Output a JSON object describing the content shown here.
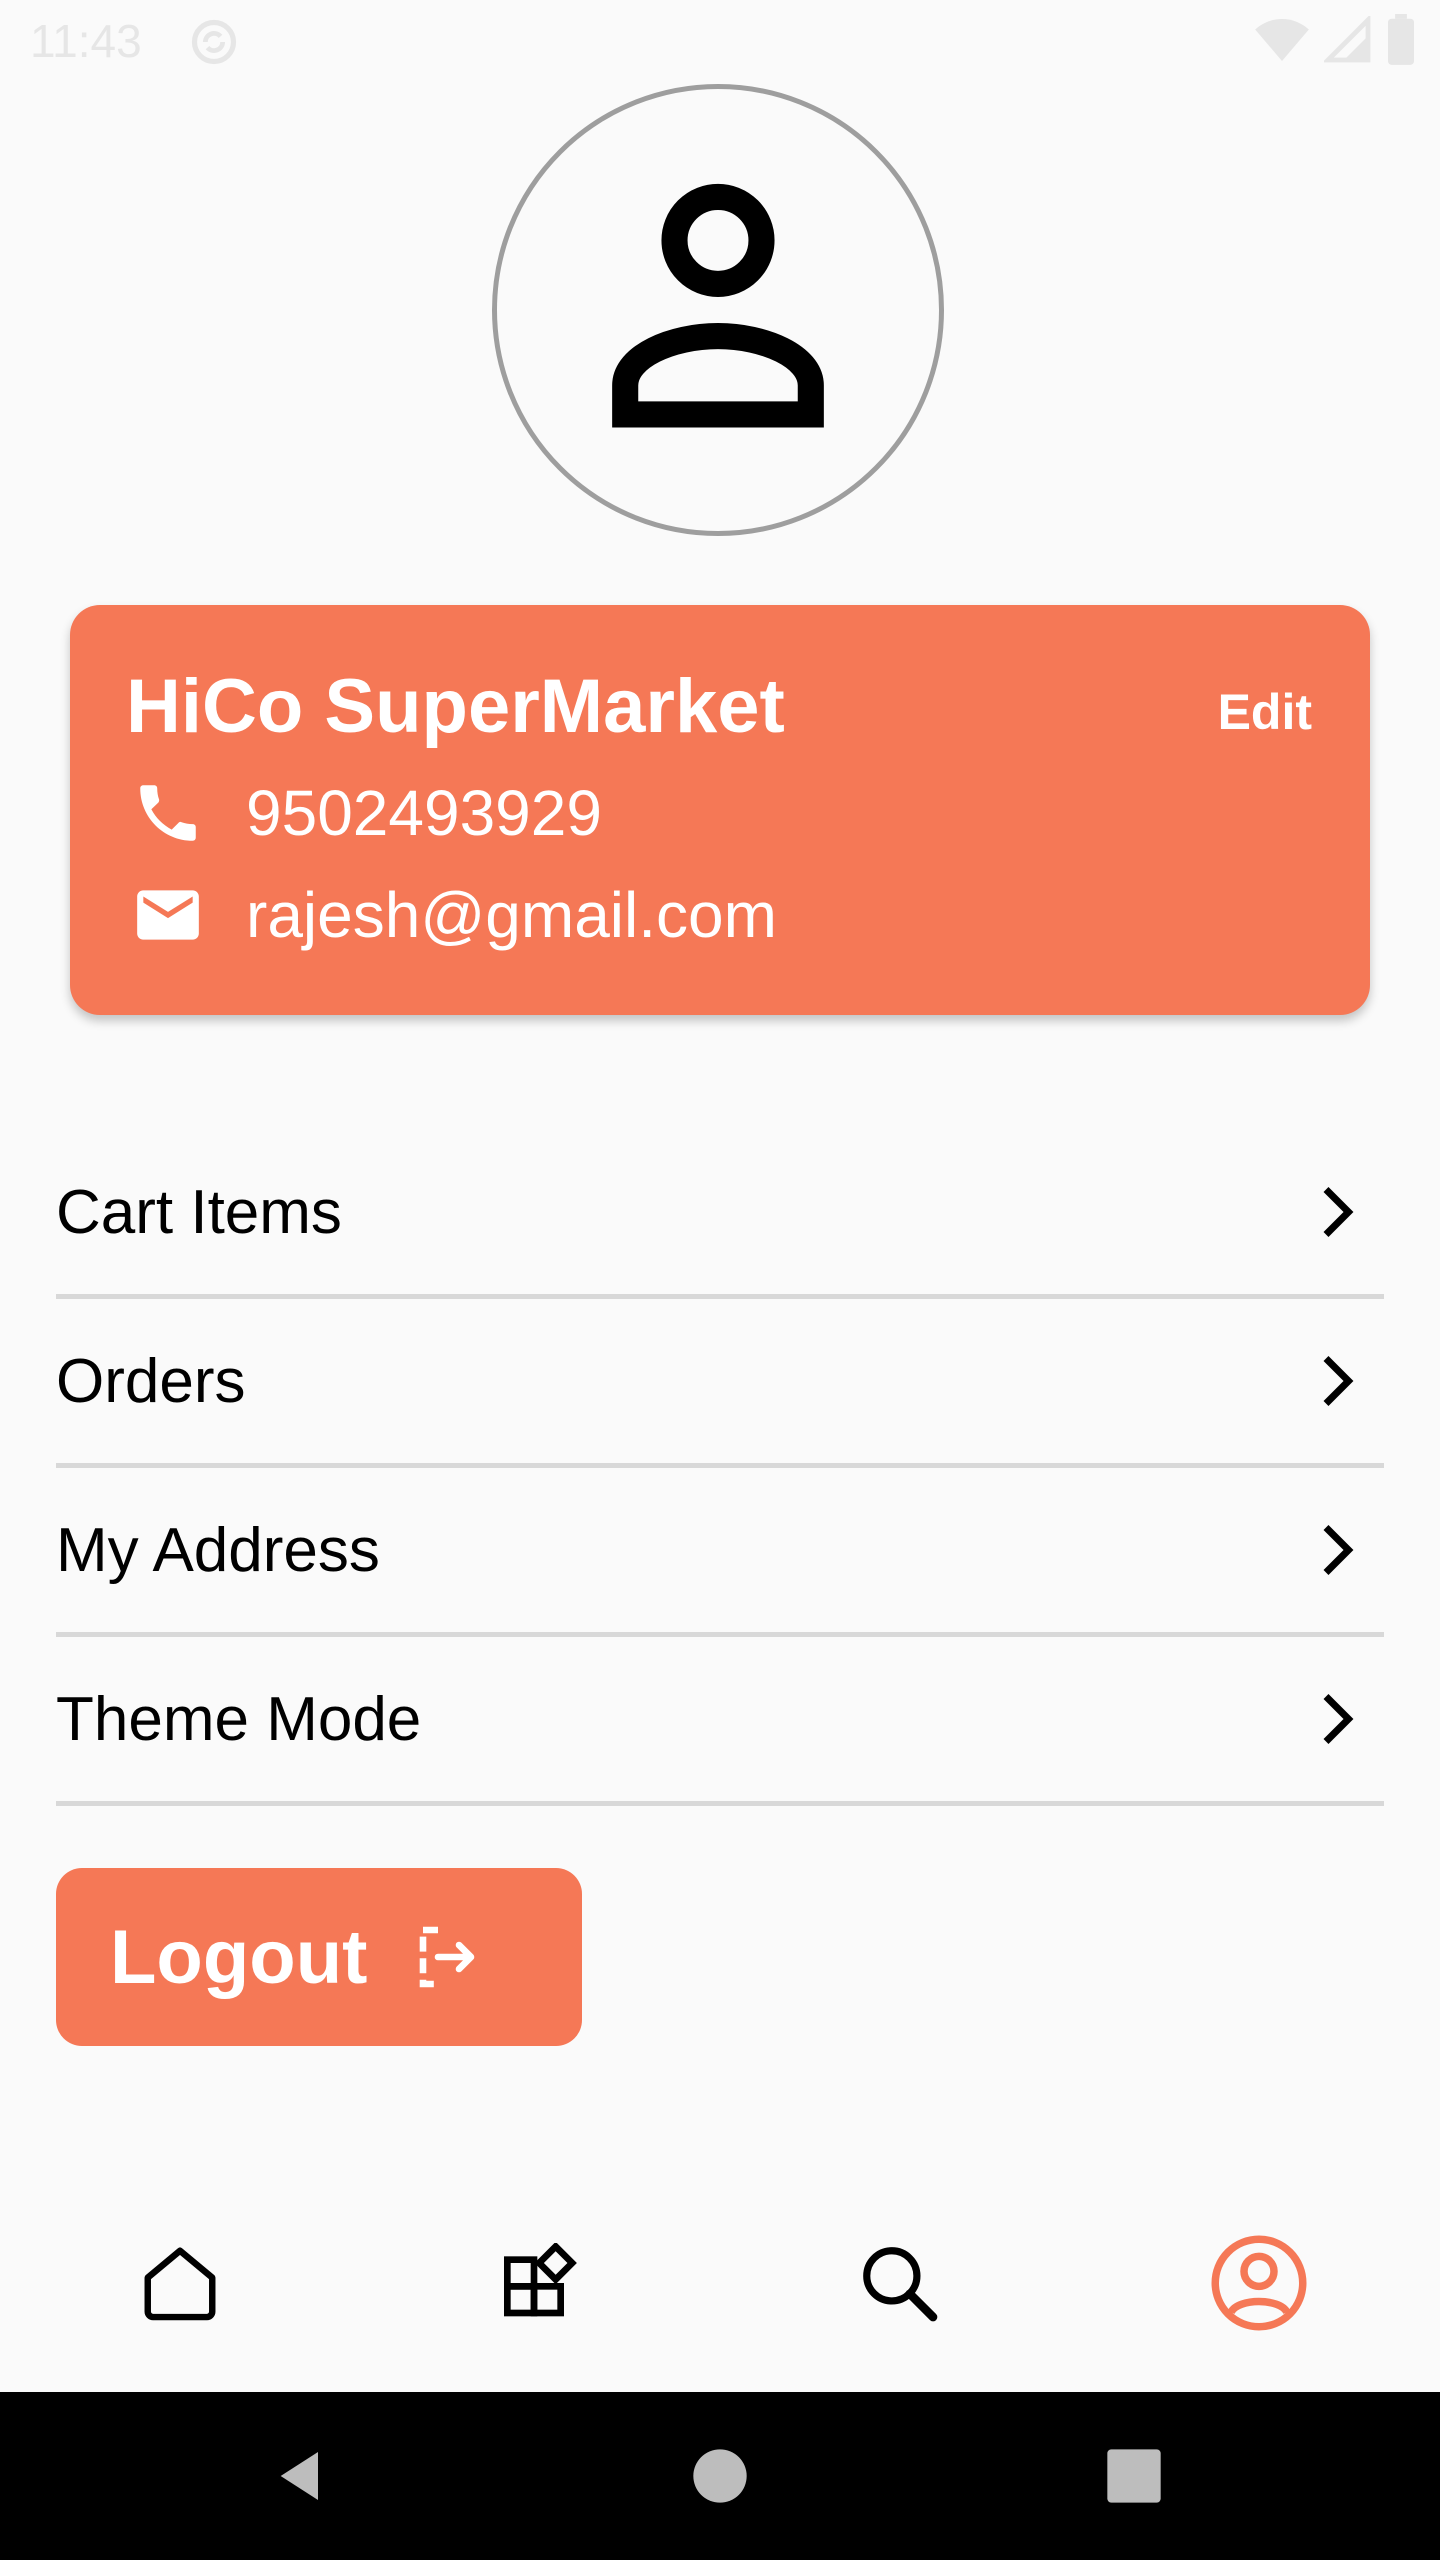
{
  "status_bar": {
    "time": "11:43"
  },
  "profile": {
    "store_name": "HiCo SuperMarket",
    "edit_label": "Edit",
    "phone": "9502493929",
    "email": "rajesh@gmail.com"
  },
  "menu": {
    "items": [
      {
        "label": "Cart Items"
      },
      {
        "label": "Orders"
      },
      {
        "label": "My Address"
      },
      {
        "label": "Theme Mode"
      }
    ]
  },
  "logout": {
    "label": "Logout"
  },
  "bottom_nav": {
    "items": [
      {
        "icon": "home-icon",
        "active": false
      },
      {
        "icon": "categories-icon",
        "active": false
      },
      {
        "icon": "search-icon",
        "active": false
      },
      {
        "icon": "profile-icon",
        "active": true
      }
    ]
  },
  "colors": {
    "accent": "#f57856",
    "background": "#fafafa",
    "divider": "#d8d8d8",
    "avatar_border": "#9e9e9e"
  }
}
